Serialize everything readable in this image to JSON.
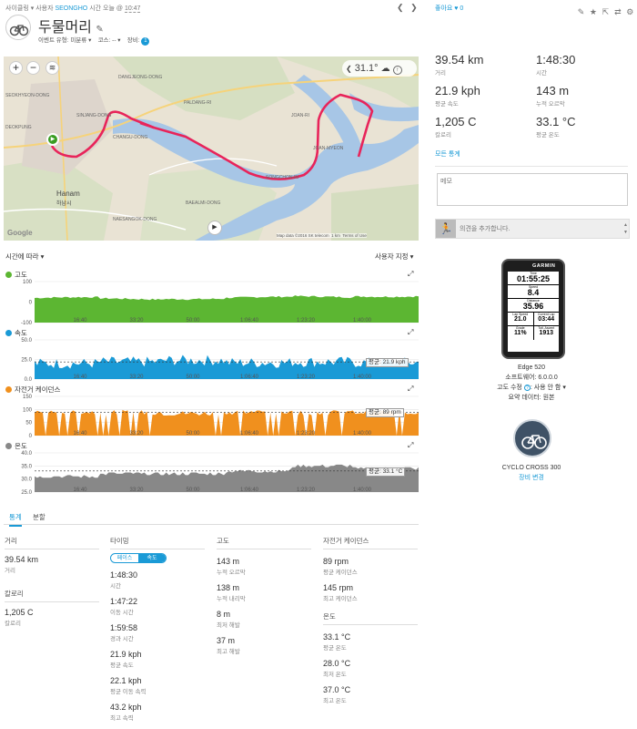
{
  "header": {
    "activity_label": "사이클링",
    "by_label": "사용자",
    "user_name": "SEONGHO",
    "time_label": "시간 오늘 @",
    "time_value": "10:47",
    "title": "두물머리",
    "event_type": "이벤트 유형: 미분류",
    "course": "코스: --",
    "gear": "장비:",
    "gear_count": "1",
    "like_label": "좋아요",
    "like_count": "0"
  },
  "map": {
    "temperature": "31.1°",
    "attribution": "Map data ©2016 SK telecom",
    "scale": "1 km",
    "terms": "Terms of Use",
    "google": "Google",
    "places": [
      "DANGJEONG-DONG",
      "DANGJEONG-DONG",
      "DEOKPUNG",
      "PALDANG-RI",
      "SINJANG-DONG",
      "SINJANG-DONG",
      "SEOKHYEON-DONG",
      "DEOKPUNG",
      "DEOKPUNG 1-DONG",
      "DEOKPUNG 2-DONG",
      "DONGHAE-DONG",
      "CHANGU-DONG",
      "JOAN-RI",
      "JOAN-MYEON",
      "SAMBONG-RI",
      "NEUNGNAE-RI",
      "SONGCHON-RI",
      "SANGSAN-GOK-DONG",
      "CHUNGBUK-DONG",
      "Hanam",
      "하남시",
      "CHEONHYEON-DONG",
      "BAEALMI-DONG",
      "NAESANGOK-DONG",
      "YANGSU-RI",
      "JINJUNG-RI",
      "GWANGWIN-DONG"
    ]
  },
  "summary": {
    "distance": {
      "value": "39.54 km",
      "label": "거리"
    },
    "time": {
      "value": "1:48:30",
      "label": "시간"
    },
    "avg_speed": {
      "value": "21.9 kph",
      "label": "평균 속도"
    },
    "elev_gain": {
      "value": "143 m",
      "label": "누적 오르막"
    },
    "calories": {
      "value": "1,205 C",
      "label": "칼로리"
    },
    "avg_temp": {
      "value": "33.1 °C",
      "label": "평균 온도"
    },
    "all_stats": "모든 통계"
  },
  "notes": {
    "placeholder": "메모",
    "comment_placeholder": "의견을 추가합니다."
  },
  "device": {
    "screen": {
      "brand": "GARMIN",
      "time_label": "Time",
      "time": "01:55:25",
      "speed_label": "Speed",
      "speed": "8.4",
      "distance_label": "Distance",
      "distance": "35.96",
      "lap_speed_label": "Lap Speed",
      "lap_speed": "21.0",
      "current_lap_label": "Current Lap",
      "current_lap": "03:44",
      "grade_label": "Grade",
      "grade": "11%",
      "ascent_label": "Totl. Ascent",
      "ascent": "1913"
    },
    "name": "Edge 520",
    "software": "소프트웨어: 6.0.0.0",
    "elev_correction": "고도 수정",
    "elev_correction_value": "사용 안 함",
    "summary_data": "요약 데이터: 원본",
    "gear_name": "CYCLO CROSS 300",
    "gear_change": "장비 변경"
  },
  "charts_header": {
    "x_mode": "시간에 따라",
    "custom": "사용자 지정"
  },
  "charts": [
    {
      "key": "elevation",
      "title": "고도",
      "color": "#5cb632",
      "yticks": [
        "100",
        "0",
        "-100"
      ],
      "badge": null
    },
    {
      "key": "speed",
      "title": "속도",
      "color": "#1a9ad6",
      "yticks": [
        "50.0",
        "25.0",
        "0.0"
      ],
      "badge": "평균: 21.9 kph"
    },
    {
      "key": "cadence",
      "title": "자전거 케이던스",
      "color": "#f0901e",
      "yticks": [
        "150",
        "100",
        "50",
        "0"
      ],
      "badge": "평균: 89 rpm"
    },
    {
      "key": "temperature",
      "title": "온도",
      "color": "#888888",
      "yticks": [
        "40.0",
        "35.0",
        "30.0",
        "25.0"
      ],
      "badge": "평균: 33.1 °C"
    }
  ],
  "xticks": [
    "16:40",
    "33:20",
    "50:00",
    "1:06:40",
    "1:23:20",
    "1:40:00"
  ],
  "tabs": {
    "stats": "통계",
    "laps": "분할"
  },
  "stats": {
    "distance_header": "거리",
    "distance": {
      "value": "39.54 km",
      "label": "거리"
    },
    "calories_header": "칼로리",
    "calories": {
      "value": "1,205 C",
      "label": "칼로리"
    },
    "timing_header": "타이밍",
    "pace_toggle": "페이스",
    "speed_toggle": "속도",
    "timing": [
      {
        "value": "1:48:30",
        "label": "시간"
      },
      {
        "value": "1:47:22",
        "label": "이동 시간"
      },
      {
        "value": "1:59:58",
        "label": "경과 시간"
      },
      {
        "value": "21.9 kph",
        "label": "평균 속도"
      },
      {
        "value": "22.1 kph",
        "label": "평균 이동 속력"
      },
      {
        "value": "43.2 kph",
        "label": "최고 속력"
      }
    ],
    "elevation_header": "고도",
    "elevation": [
      {
        "value": "143 m",
        "label": "누적 오르막"
      },
      {
        "value": "138 m",
        "label": "누적 내리막"
      },
      {
        "value": "8 m",
        "label": "최저 해발"
      },
      {
        "value": "37 m",
        "label": "최고 해발"
      }
    ],
    "cadence_header": "자전거 케이던스",
    "cadence": [
      {
        "value": "89 rpm",
        "label": "평균 케이던스"
      },
      {
        "value": "145 rpm",
        "label": "최고 케이던스"
      }
    ],
    "temp_header": "온도",
    "temperature": [
      {
        "value": "33.1 °C",
        "label": "평균 온도"
      },
      {
        "value": "28.0 °C",
        "label": "최저 온도"
      },
      {
        "value": "37.0 °C",
        "label": "최고 온도"
      }
    ]
  },
  "chart_data": [
    {
      "type": "area",
      "title": "고도",
      "x": [
        "16:40",
        "33:20",
        "50:00",
        "1:06:40",
        "1:23:20",
        "1:40:00"
      ],
      "ylim": [
        -100,
        100
      ],
      "series": [
        {
          "name": "고도",
          "values": [
            20,
            15,
            18,
            22,
            25,
            30
          ]
        }
      ]
    },
    {
      "type": "area",
      "title": "속도",
      "x": [
        "16:40",
        "33:20",
        "50:00",
        "1:06:40",
        "1:23:20",
        "1:40:00"
      ],
      "ylim": [
        0,
        50
      ],
      "series": [
        {
          "name": "속도",
          "values": [
            20,
            22,
            24,
            21,
            22,
            21
          ]
        }
      ]
    },
    {
      "type": "area",
      "title": "자전거 케이던스",
      "x": [
        "16:40",
        "33:20",
        "50:00",
        "1:06:40",
        "1:23:20",
        "1:40:00"
      ],
      "ylim": [
        0,
        150
      ],
      "series": [
        {
          "name": "자전거 케이던스",
          "values": [
            90,
            88,
            85,
            90,
            88,
            89
          ]
        }
      ]
    },
    {
      "type": "area",
      "title": "온도",
      "x": [
        "16:40",
        "33:20",
        "50:00",
        "1:06:40",
        "1:23:20",
        "1:40:00"
      ],
      "ylim": [
        25,
        40
      ],
      "series": [
        {
          "name": "온도",
          "values": [
            31,
            32,
            32,
            33,
            35,
            34
          ]
        }
      ]
    }
  ]
}
